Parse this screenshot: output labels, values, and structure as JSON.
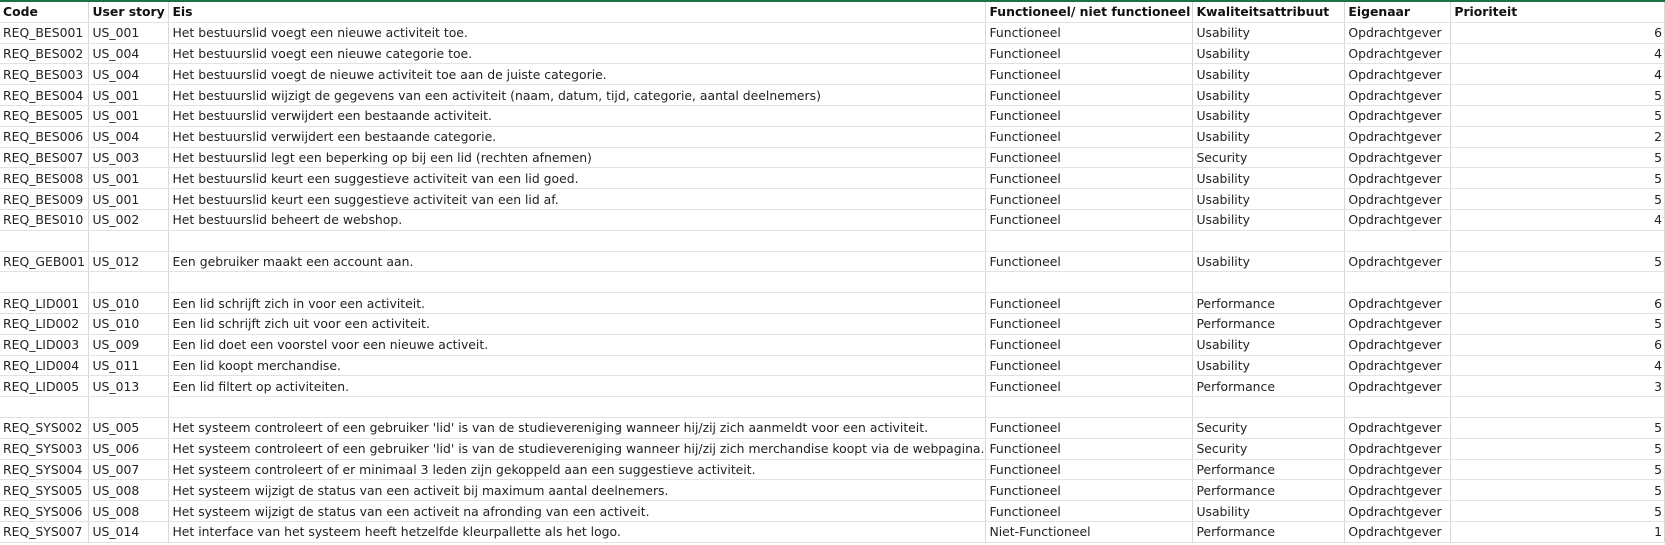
{
  "sheet": {
    "headers": [
      "Code",
      "User story",
      "Eis",
      "Functioneel/ niet functioneel",
      "Kwaliteitsattribuut",
      "Eigenaar",
      "Prioriteit"
    ],
    "rows": [
      [
        "REQ_BES001",
        "US_001",
        "Het bestuurslid voegt een nieuwe activiteit toe.",
        "Functioneel",
        "Usability",
        "Opdrachtgever",
        "6"
      ],
      [
        "REQ_BES002",
        "US_004",
        "Het bestuurslid voegt een nieuwe categorie toe.",
        "Functioneel",
        "Usability",
        "Opdrachtgever",
        "4"
      ],
      [
        "REQ_BES003",
        "US_004",
        "Het bestuurslid voegt de nieuwe activiteit toe aan de juiste categorie.",
        "Functioneel",
        "Usability",
        "Opdrachtgever",
        "4"
      ],
      [
        "REQ_BES004",
        "US_001",
        "Het bestuurslid wijzigt de gegevens van een activiteit (naam, datum, tijd, categorie, aantal deelnemers)",
        "Functioneel",
        "Usability",
        "Opdrachtgever",
        "5"
      ],
      [
        "REQ_BES005",
        "US_001",
        "Het bestuurslid verwijdert een bestaande activiteit.",
        "Functioneel",
        "Usability",
        "Opdrachtgever",
        "5"
      ],
      [
        "REQ_BES006",
        "US_004",
        "Het bestuurslid verwijdert een bestaande categorie.",
        "Functioneel",
        "Usability",
        "Opdrachtgever",
        "2"
      ],
      [
        "REQ_BES007",
        "US_003",
        "Het bestuurslid legt een beperking op bij een lid (rechten afnemen)",
        "Functioneel",
        "Security",
        "Opdrachtgever",
        "5"
      ],
      [
        "REQ_BES008",
        "US_001",
        "Het bestuurslid keurt een suggestieve activiteit van een lid goed.",
        "Functioneel",
        "Usability",
        "Opdrachtgever",
        "5"
      ],
      [
        "REQ_BES009",
        "US_001",
        "Het bestuurslid keurt een suggestieve activiteit van een lid af.",
        "Functioneel",
        "Usability",
        "Opdrachtgever",
        "5"
      ],
      [
        "REQ_BES010",
        "US_002",
        "Het bestuurslid beheert de webshop.",
        "Functioneel",
        "Usability",
        "Opdrachtgever",
        "4"
      ],
      [
        "",
        "",
        "",
        "",
        "",
        "",
        ""
      ],
      [
        "REQ_GEB001",
        "US_012",
        "Een gebruiker maakt een account aan.",
        "Functioneel",
        "Usability",
        "Opdrachtgever",
        "5"
      ],
      [
        "",
        "",
        "",
        "",
        "",
        "",
        ""
      ],
      [
        "REQ_LID001",
        "US_010",
        "Een lid schrijft zich in voor een activiteit.",
        "Functioneel",
        "Performance",
        "Opdrachtgever",
        "6"
      ],
      [
        "REQ_LID002",
        "US_010",
        "Een lid schrijft zich uit voor een activiteit.",
        "Functioneel",
        "Performance",
        "Opdrachtgever",
        "5"
      ],
      [
        "REQ_LID003",
        "US_009",
        "Een lid doet een voorstel voor een nieuwe activeit.",
        "Functioneel",
        "Usability",
        "Opdrachtgever",
        "6"
      ],
      [
        "REQ_LID004",
        "US_011",
        "Een lid koopt merchandise.",
        "Functioneel",
        "Usability",
        "Opdrachtgever",
        "4"
      ],
      [
        "REQ_LID005",
        "US_013",
        "Een lid filtert op activiteiten.",
        "Functioneel",
        "Performance",
        "Opdrachtgever",
        "3"
      ],
      [
        "",
        "",
        "",
        "",
        "",
        "",
        ""
      ],
      [
        "REQ_SYS002",
        "US_005",
        "Het systeem controleert of een gebruiker 'lid' is van de studievereniging wanneer hij/zij zich aanmeldt voor een activiteit.",
        "Functioneel",
        "Security",
        "Opdrachtgever",
        "5"
      ],
      [
        "REQ_SYS003",
        "US_006",
        "Het systeem controleert of een gebruiker 'lid' is van de studievereniging wanneer hij/zij zich merchandise koopt via de webpagina.",
        "Functioneel",
        "Security",
        "Opdrachtgever",
        "5"
      ],
      [
        "REQ_SYS004",
        "US_007",
        "Het systeem controleert of er minimaal 3 leden zijn gekoppeld aan een suggestieve activiteit.",
        "Functioneel",
        "Performance",
        "Opdrachtgever",
        "5"
      ],
      [
        "REQ_SYS005",
        "US_008",
        "Het systeem wijzigt de status van een activeit bij maximum aantal deelnemers.",
        "Functioneel",
        "Performance",
        "Opdrachtgever",
        "5"
      ],
      [
        "REQ_SYS006",
        "US_008",
        "Het systeem wijzigt de status van een activeit na afronding van een activeit.",
        "Functioneel",
        "Usability",
        "Opdrachtgever",
        "5"
      ],
      [
        "REQ_SYS007",
        "US_014",
        "Het interface van het systeem heeft hetzelfde kleurpallette als het logo.",
        "Niet-Functioneel",
        "Performance",
        "Opdrachtgever",
        "1"
      ]
    ]
  }
}
